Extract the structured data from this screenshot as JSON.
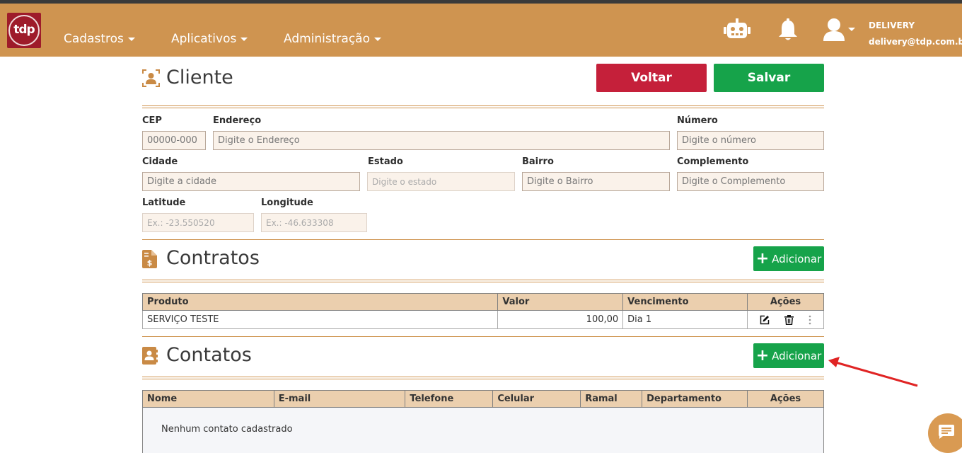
{
  "navbar": {
    "logo_text": "tdp",
    "menu": [
      {
        "label": "Cadastros"
      },
      {
        "label": "Aplicativos"
      },
      {
        "label": "Administração"
      }
    ],
    "user_name": "DELIVERY",
    "user_email": "delivery@tdp.com.br"
  },
  "header": {
    "title": "Cliente",
    "back_label": "Voltar",
    "save_label": "Salvar"
  },
  "address_form": {
    "cep": {
      "label": "CEP",
      "placeholder": "00000-000"
    },
    "endereco": {
      "label": "Endereço",
      "placeholder": "Digite o Endereço"
    },
    "numero": {
      "label": "Número",
      "placeholder": "Digite o número"
    },
    "cidade": {
      "label": "Cidade",
      "placeholder": "Digite a cidade"
    },
    "estado": {
      "label": "Estado",
      "placeholder": "Digite o estado"
    },
    "bairro": {
      "label": "Bairro",
      "placeholder": "Digite o Bairro"
    },
    "complemento": {
      "label": "Complemento",
      "placeholder": "Digite o Complemento"
    },
    "latitude": {
      "label": "Latitude",
      "placeholder": "Ex.: -23.550520"
    },
    "longitude": {
      "label": "Longitude",
      "placeholder": "Ex.: -46.633308"
    }
  },
  "contratos": {
    "title": "Contratos",
    "add_label": "Adicionar",
    "columns": [
      "Produto",
      "Valor",
      "Vencimento",
      "Ações"
    ],
    "rows": [
      {
        "produto": "SERVIÇO TESTE",
        "valor": "100,00",
        "vencimento": "Dia 1"
      }
    ]
  },
  "contatos": {
    "title": "Contatos",
    "add_label": "Adicionar",
    "columns": [
      "Nome",
      "E-mail",
      "Telefone",
      "Celular",
      "Ramal",
      "Departamento",
      "Ações"
    ],
    "empty_message": "Nenhum contato cadastrado"
  },
  "colors": {
    "brand": "#cf9450",
    "danger": "#c5203a",
    "success": "#16a34a",
    "table_header": "#ebcfae"
  }
}
